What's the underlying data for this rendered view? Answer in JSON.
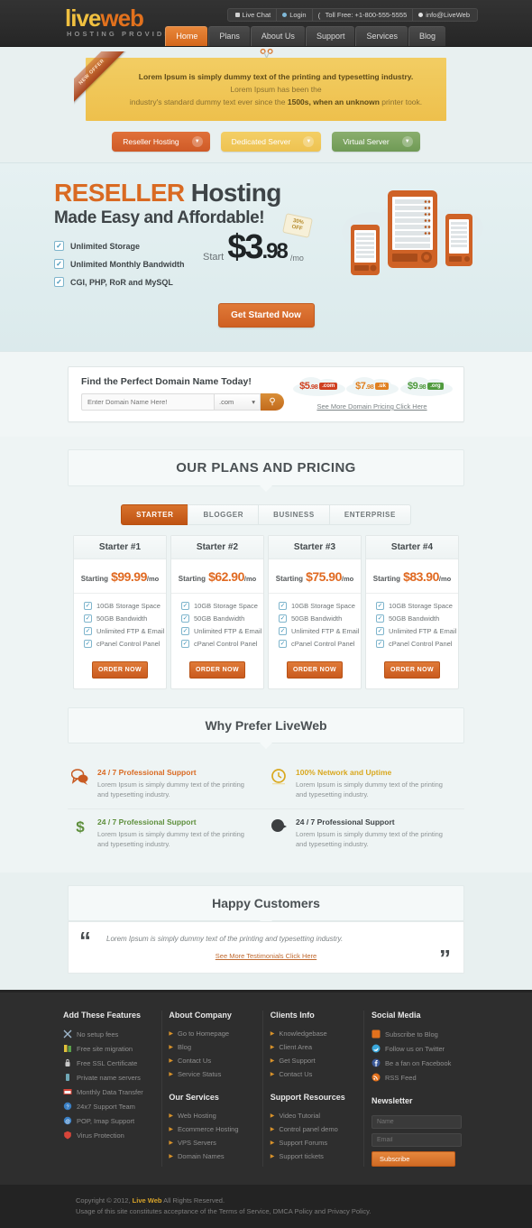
{
  "brand": {
    "name_part1": "live",
    "name_part2": "web",
    "tagline": "HOSTING PROVIDER"
  },
  "topbar": {
    "util": [
      {
        "icon": "chat-icon",
        "label": "Live Chat"
      },
      {
        "icon": "login-icon",
        "label": "Login"
      },
      {
        "icon": "phone-icon",
        "label": "Toll Free: +1-800-555-5555"
      },
      {
        "icon": "mail-icon",
        "label": "info@LiveWeb"
      }
    ],
    "nav": [
      {
        "label": "Home",
        "active": true
      },
      {
        "label": "Plans",
        "active": false
      },
      {
        "label": "About Us",
        "active": false
      },
      {
        "label": "Support",
        "active": false
      },
      {
        "label": "Services",
        "active": false
      },
      {
        "label": "Blog",
        "active": false
      }
    ]
  },
  "offer": {
    "ribbon": "NEW OFFER",
    "bold1": "Lorem Ipsum is simply dummy text of the printing and typesetting industry.",
    "rest1": " Lorem Ipsum has been the",
    "rest2": "industry's standard dummy text ever since the ",
    "bold2": "1500s, when an unknown",
    "rest3": " printer took."
  },
  "product_buttons": [
    {
      "label": "Reseller Hosting",
      "color": "orange"
    },
    {
      "label": "Dedicated Server",
      "color": "yellow"
    },
    {
      "label": "Virtual Server",
      "color": "green"
    }
  ],
  "hero": {
    "title_hl": "RESELLER",
    "title_rest": " Hosting",
    "subtitle": "Made Easy and Affordable!",
    "features": [
      "Unlimited Storage",
      "Unlimited Monthly Bandwidth",
      "CGI, PHP, RoR and MySQL"
    ],
    "price_start": "Start",
    "price_currency": "$",
    "price_whole": "3",
    "price_cents": ".98",
    "price_period": "/mo",
    "discount_line1": "30%",
    "discount_line2": "OFF",
    "cta": "Get Started Now",
    "arrow_left": "‹",
    "arrow_right": "›"
  },
  "domain_search": {
    "title": "Find the Perfect Domain Name Today!",
    "placeholder": "Enter Domain Name Here!",
    "tld_selected": ".com",
    "search_icon": "search-icon",
    "tlds": [
      {
        "currency": "$",
        "whole": "5",
        "cents": ".98",
        "ext": ".com",
        "color": "red"
      },
      {
        "currency": "$",
        "whole": "7",
        "cents": ".98",
        "ext": ".uk",
        "color": "orange2"
      },
      {
        "currency": "$",
        "whole": "9",
        "cents": ".98",
        "ext": ".org",
        "color": "green2"
      }
    ],
    "more_link": "See More Domain Pricing Click Here"
  },
  "plans": {
    "heading": "OUR PLANS AND PRICING",
    "tabs": [
      {
        "label": "STARTER",
        "active": true
      },
      {
        "label": "BLOGGER",
        "active": false
      },
      {
        "label": "BUSINESS",
        "active": false
      },
      {
        "label": "ENTERPRISE",
        "active": false
      }
    ],
    "starting_label": "Starting",
    "per_month": "/mo",
    "order_label": "ORDER NOW",
    "cards": [
      {
        "title": "Starter #1",
        "price": "$99.99",
        "features": [
          "10GB Storage Space",
          "50GB Bandwidth",
          "Unlimited FTP & Email",
          "cPanel Control Panel"
        ]
      },
      {
        "title": "Starter #2",
        "price": "$62.90",
        "features": [
          "10GB Storage Space",
          "50GB Bandwidth",
          "Unlimited FTP & Email",
          "cPanel Control Panel"
        ]
      },
      {
        "title": "Starter #3",
        "price": "$75.90",
        "features": [
          "10GB Storage Space",
          "50GB Bandwidth",
          "Unlimited FTP & Email",
          "cPanel Control Panel"
        ]
      },
      {
        "title": "Starter #4",
        "price": "$83.90",
        "features": [
          "10GB Storage Space",
          "50GB Bandwidth",
          "Unlimited FTP & Email",
          "cPanel Control Panel"
        ]
      }
    ]
  },
  "why": {
    "heading": "Why Prefer LiveWeb",
    "items": [
      {
        "icon": "speech-bubble-icon",
        "title": "24 / 7 Professional Support",
        "color": "orange",
        "desc": "Lorem Ipsum is simply dummy text of the printing and typesetting industry."
      },
      {
        "icon": "clock-icon",
        "title": "100% Network and Uptime",
        "color": "gold",
        "desc": "Lorem Ipsum is simply dummy text of the printing and typesetting industry."
      },
      {
        "icon": "dollar-icon",
        "title": "24 / 7 Professional Support",
        "color": "green",
        "desc": "Lorem Ipsum is simply dummy text of the printing and typesetting industry."
      },
      {
        "icon": "pie-chart-icon",
        "title": "24 / 7 Professional Support",
        "color": "dark",
        "desc": "Lorem Ipsum is simply dummy text of the printing and typesetting industry."
      }
    ]
  },
  "testimonials": {
    "heading": "Happy Customers",
    "quote_open": "“",
    "quote_close": "”",
    "text": "Lorem Ipsum is simply dummy text of the printing and typesetting industry.",
    "more_link": "See More Testimonials Click Here"
  },
  "footer": {
    "col1": {
      "heading": "Add These Features",
      "items": [
        {
          "icon": "tools-icon",
          "label": "No setup fees"
        },
        {
          "icon": "migration-icon",
          "label": "Free site migration"
        },
        {
          "icon": "lock-icon",
          "label": "Free SSL Certificate"
        },
        {
          "icon": "server-icon",
          "label": "Private name servers"
        },
        {
          "icon": "transfer-icon",
          "label": "Monthly Data Transfer"
        },
        {
          "icon": "support-icon",
          "label": "24x7 Support Team"
        },
        {
          "icon": "mail-icon",
          "label": "POP, Imap Support"
        },
        {
          "icon": "shield-icon",
          "label": "Virus Protection"
        }
      ]
    },
    "col2": {
      "heading": "About Company",
      "items": [
        "Go to Homepage",
        "Blog",
        "Contact Us",
        "Service Status"
      ],
      "heading2": "Our Services",
      "items2": [
        "Web Hosting",
        "Ecommerce Hosting",
        "VPS Servers",
        "Domain Names"
      ]
    },
    "col3": {
      "heading": "Clients Info",
      "items": [
        "Knowledgebase",
        "Client Area",
        "Get Support",
        "Contact Us"
      ],
      "heading2": "Support Resources",
      "items2": [
        "Video Tutorial",
        "Control panel demo",
        "Support Forums",
        "Support tickets"
      ]
    },
    "col4": {
      "heading": "Social Media",
      "items": [
        {
          "icon": "rss-square-icon",
          "label": "Subscribe to Blog",
          "color": "#e2711d"
        },
        {
          "icon": "twitter-icon",
          "label": "Follow us on Twitter",
          "color": "#3aa8dc"
        },
        {
          "icon": "facebook-icon",
          "label": "Be a fan on Facebook",
          "color": "#3b5998"
        },
        {
          "icon": "rss-icon",
          "label": "RSS Feed",
          "color": "#e2711d"
        }
      ],
      "heading2": "Newsletter",
      "name_placeholder": "Name",
      "email_placeholder": "Email",
      "subscribe_label": "Subscribe"
    }
  },
  "copyright": {
    "line1_a": "Copyright © 2012, ",
    "brand": "Live Web",
    "line1_b": " All Rights Reserved.",
    "line2": "Usage of this site constitutes acceptance of the Terms of Service, DMCA Policy and Privacy Policy."
  }
}
